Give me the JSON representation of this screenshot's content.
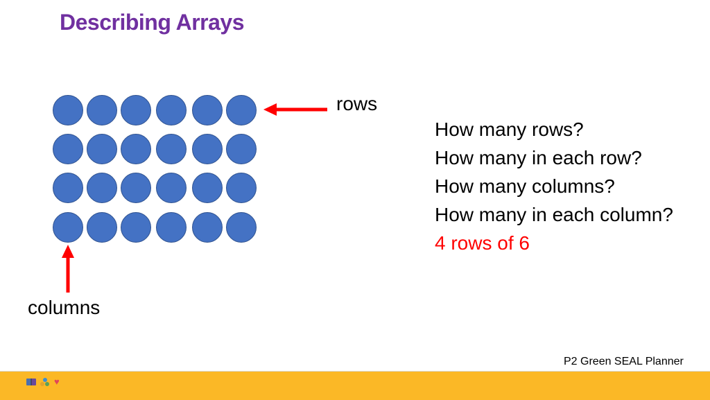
{
  "slide": {
    "title": "Describing Arrays",
    "array": {
      "rows": 4,
      "columns": 6,
      "dot_color": "#4472c4",
      "dot_border_color": "#2f528f"
    },
    "labels": {
      "rows": "rows",
      "columns": "columns"
    },
    "arrow_color": "#ff0000",
    "questions": [
      "How many rows?",
      "How many in each row?",
      "How many columns?",
      "How many in each column?"
    ],
    "answer": "4 rows of 6",
    "answer_color": "#ff0000"
  },
  "footer": {
    "text": "P2 Green SEAL Planner",
    "bar_color": "#fbb826",
    "icons": [
      "book-icon",
      "people-icon",
      "heart-icon"
    ]
  }
}
